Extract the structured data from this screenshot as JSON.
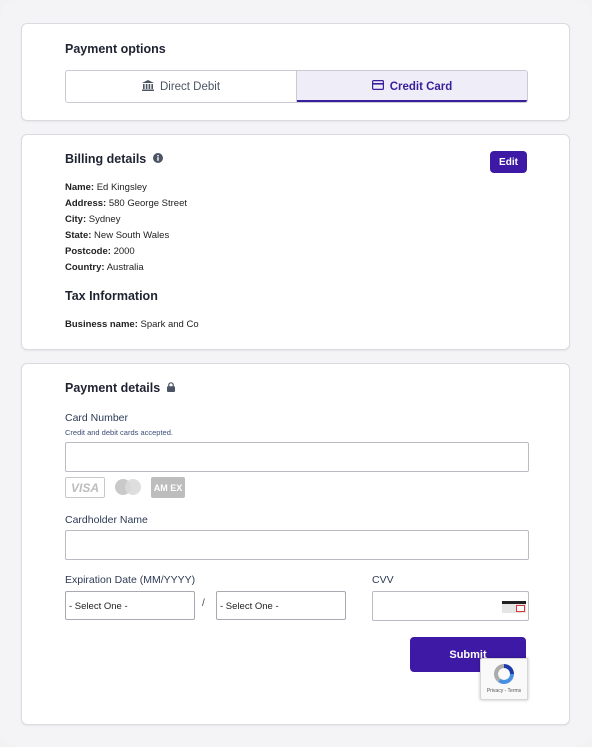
{
  "payment_options": {
    "title": "Payment options",
    "options": [
      {
        "label": "Direct Debit",
        "icon": "bank-icon",
        "active": false
      },
      {
        "label": "Credit Card",
        "icon": "credit-card-icon",
        "active": true
      }
    ]
  },
  "billing": {
    "title": "Billing details",
    "edit_label": "Edit",
    "rows": [
      {
        "label": "Name:",
        "value": "Ed Kingsley"
      },
      {
        "label": "Address:",
        "value": "580 George Street"
      },
      {
        "label": "City:",
        "value": "Sydney"
      },
      {
        "label": "State:",
        "value": "New South Wales"
      },
      {
        "label": "Postcode:",
        "value": "2000"
      },
      {
        "label": "Country:",
        "value": "Australia"
      }
    ],
    "tax_title": "Tax Information",
    "business_label": "Business name:",
    "business_value": "Spark and Co"
  },
  "payment": {
    "title": "Payment details",
    "card_number_label": "Card Number",
    "card_number_helper": "Credit and debit cards accepted.",
    "brands": [
      "VISA",
      "AM EX"
    ],
    "cardholder_label": "Cardholder Name",
    "expiry_label": "Expiration Date (MM/YYYY)",
    "month_value": "- Select One -",
    "year_value": "- Select One -",
    "slash": "/",
    "cvv_label": "CVV",
    "submit_label": "Submit",
    "recaptcha_terms": "Privacy - Terms"
  },
  "colors": {
    "accent": "#3d19a6",
    "active_tab_bg": "#eeedf8"
  }
}
